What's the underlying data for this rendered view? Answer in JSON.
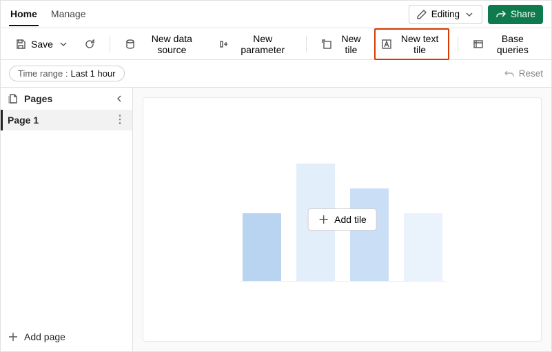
{
  "tabs": {
    "home": "Home",
    "manage": "Manage"
  },
  "header": {
    "editing": "Editing",
    "share": "Share"
  },
  "toolbar": {
    "save": "Save",
    "new_data_source": "New data source",
    "new_parameter": "New parameter",
    "new_tile": "New tile",
    "new_text_tile": "New text tile",
    "base_queries": "Base queries"
  },
  "subbar": {
    "time_label": "Time range :",
    "time_value": "Last 1 hour",
    "reset": "Reset"
  },
  "sidebar": {
    "title": "Pages",
    "items": [
      {
        "label": "Page 1",
        "active": true
      }
    ],
    "add_page": "Add page"
  },
  "canvas": {
    "add_tile": "Add tile"
  }
}
